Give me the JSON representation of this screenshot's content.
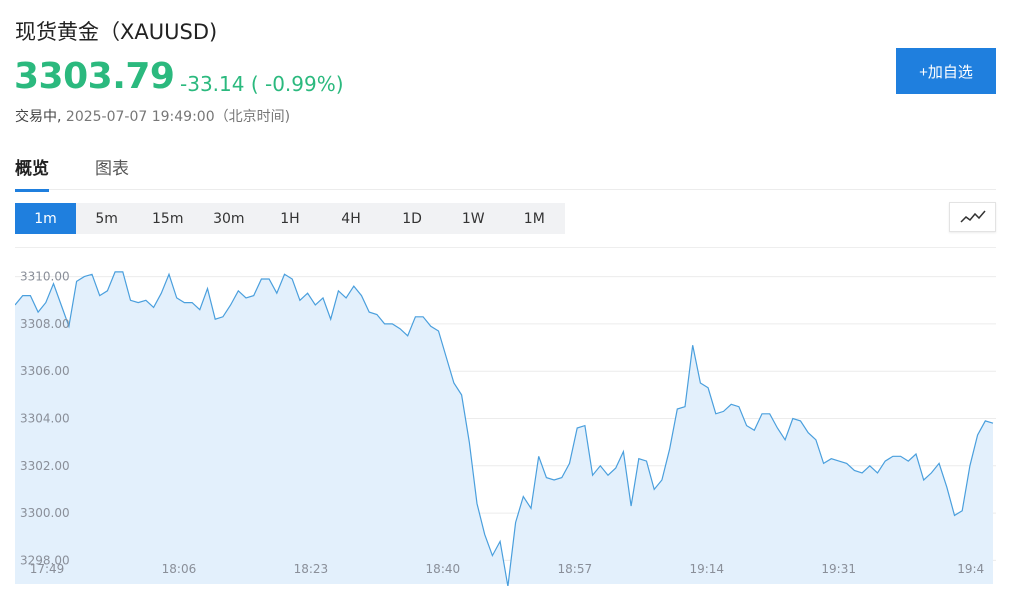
{
  "header": {
    "title": "现货黄金（XAUUSD)",
    "price": "3303.79",
    "change": "-33.14 ( -0.99%)",
    "status_label": "交易中,",
    "timestamp": "2025-07-07 19:49:00（北京时间)"
  },
  "actions": {
    "add_watchlist": "+加自选"
  },
  "tabs": [
    {
      "label": "概览",
      "active": true
    },
    {
      "label": "图表",
      "active": false
    }
  ],
  "periods": [
    {
      "label": "1m",
      "active": true
    },
    {
      "label": "5m",
      "active": false
    },
    {
      "label": "15m",
      "active": false
    },
    {
      "label": "30m",
      "active": false
    },
    {
      "label": "1H",
      "active": false
    },
    {
      "label": "4H",
      "active": false
    },
    {
      "label": "1D",
      "active": false
    },
    {
      "label": "1W",
      "active": false
    },
    {
      "label": "1M",
      "active": false
    }
  ],
  "icons": {
    "chart_type": "line-chart-icon"
  },
  "colors": {
    "accent": "#1f7fde",
    "positive": "#2bb97e",
    "line": "#4a9fdd",
    "area": "#e3f0fc"
  },
  "chart_data": {
    "type": "area",
    "ylim": [
      3297,
      3311
    ],
    "y_ticks": [
      "3310.00",
      "3308.00",
      "3306.00",
      "3304.00",
      "3302.00",
      "3300.00",
      "3298.00"
    ],
    "y_tick_values": [
      3310,
      3308,
      3306,
      3304,
      3302,
      3300,
      3298
    ],
    "x_ticks": [
      "17:49",
      "18:06",
      "18:23",
      "18:40",
      "18:57",
      "19:14",
      "19:31",
      "19:4"
    ],
    "x_tick_minutes": [
      0,
      17,
      34,
      51,
      68,
      85,
      102,
      119
    ],
    "x_range": [
      0,
      126
    ],
    "grid": true,
    "series": [
      {
        "values": [
          3308.8,
          3309.2,
          3309.2,
          3308.5,
          3308.9,
          3309.7,
          3308.8,
          3307.9,
          3309.8,
          3310.0,
          3310.1,
          3309.2,
          3309.4,
          3310.2,
          3310.2,
          3309.0,
          3308.9,
          3309.0,
          3308.7,
          3309.3,
          3310.1,
          3309.1,
          3308.9,
          3308.9,
          3308.6,
          3309.5,
          3308.2,
          3308.3,
          3308.8,
          3309.4,
          3309.1,
          3309.2,
          3309.9,
          3309.9,
          3309.3,
          3310.1,
          3309.9,
          3309.0,
          3309.3,
          3308.8,
          3309.1,
          3308.2,
          3309.4,
          3309.1,
          3309.6,
          3309.2,
          3308.5,
          3308.4,
          3308.0,
          3308.0,
          3307.8,
          3307.5,
          3308.3,
          3308.3,
          3307.9,
          3307.7,
          3306.6,
          3305.5,
          3305.0,
          3303.0,
          3300.4,
          3299.1,
          3298.2,
          3298.8,
          3296.9,
          3299.6,
          3300.7,
          3300.2,
          3302.4,
          3301.5,
          3301.4,
          3301.5,
          3302.1,
          3303.6,
          3303.7,
          3301.6,
          3302.0,
          3301.6,
          3301.9,
          3302.6,
          3300.3,
          3302.3,
          3302.2,
          3301.0,
          3301.4,
          3302.7,
          3304.4,
          3304.5,
          3307.1,
          3305.5,
          3305.3,
          3304.2,
          3304.3,
          3304.6,
          3304.5,
          3303.7,
          3303.5,
          3304.2,
          3304.2,
          3303.6,
          3303.1,
          3304.0,
          3303.9,
          3303.4,
          3303.1,
          3302.1,
          3302.3,
          3302.2,
          3302.1,
          3301.8,
          3301.7,
          3302.0,
          3301.7,
          3302.2,
          3302.4,
          3302.4,
          3302.2,
          3302.5,
          3301.4,
          3301.7,
          3302.1,
          3301.1,
          3299.9,
          3300.1,
          3302.0,
          3303.3,
          3303.9,
          3303.8
        ]
      }
    ]
  }
}
